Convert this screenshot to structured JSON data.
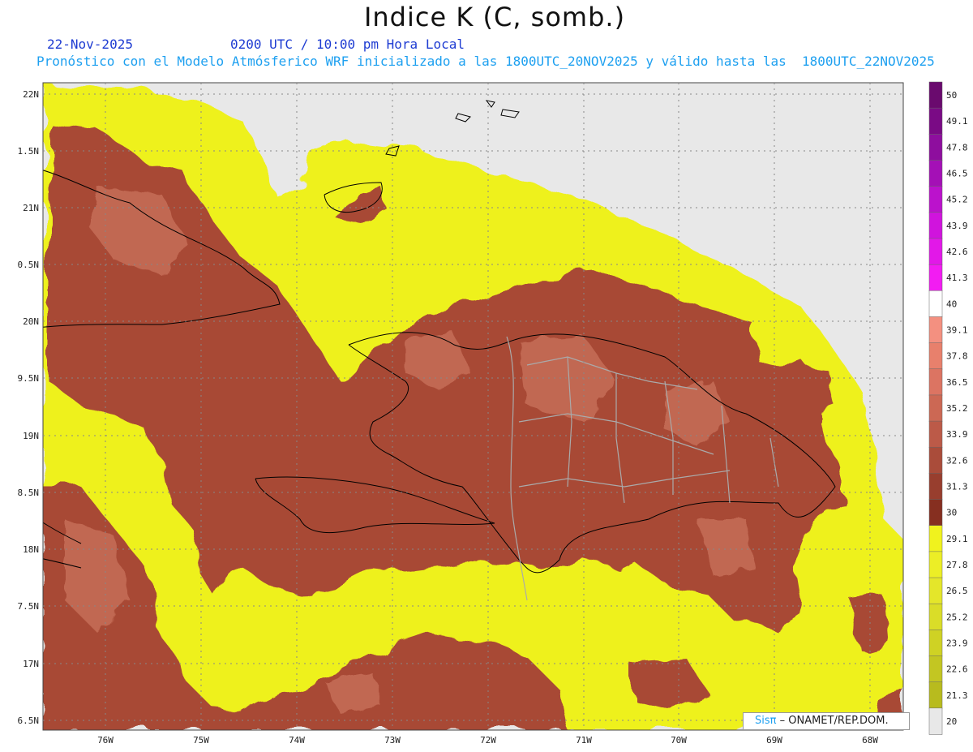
{
  "header": {
    "title": "Indice K (C, somb.)",
    "date": "22-Nov-2025",
    "time": "0200 UTC / 10:00 pm Hora Local",
    "description": "Pronóstico con el Modelo Atmósferico WRF inicializado a las 1800UTC_20NOV2025 y válido hasta las  1800UTC_22NOV2025"
  },
  "map": {
    "lat_labels": [
      "22N",
      "1.5N",
      "21N",
      "0.5N",
      "20N",
      "9.5N",
      "19N",
      "8.5N",
      "18N",
      "7.5N",
      "17N",
      "6.5N"
    ],
    "lon_labels": [
      "76W",
      "75W",
      "74W",
      "73W",
      "72W",
      "71W",
      "70W",
      "69W",
      "68W"
    ],
    "colors": {
      "no_data": "#e8e8e8",
      "low": "#eef11e",
      "mid": "#a84a35",
      "high": "#c8705a"
    }
  },
  "colorbar": {
    "labels": [
      "50",
      "49.1",
      "47.8",
      "46.5",
      "45.2",
      "43.9",
      "42.6",
      "41.3",
      "40",
      "39.1",
      "37.8",
      "36.5",
      "35.2",
      "33.9",
      "32.6",
      "31.3",
      "30",
      "29.1",
      "27.8",
      "26.5",
      "25.2",
      "23.9",
      "22.6",
      "21.3",
      "20"
    ],
    "colors": [
      "#6a0a6e",
      "#7a0a85",
      "#8e0e9e",
      "#a410b6",
      "#bb12cc",
      "#d014dd",
      "#e218e8",
      "#f21cf2",
      "#ffffff",
      "#f49080",
      "#e8806c",
      "#dc7462",
      "#cc6854",
      "#bc5a48",
      "#aa4c3a",
      "#983e2e",
      "#862f20",
      "#f0f21e",
      "#ecee26",
      "#e4e62a",
      "#dadd28",
      "#cfd224",
      "#c3c622",
      "#b8bb1e",
      "#e8e8e8"
    ]
  },
  "credit": {
    "logo": "Sisπ",
    "text": "– ONAMET/REP.DOM."
  }
}
